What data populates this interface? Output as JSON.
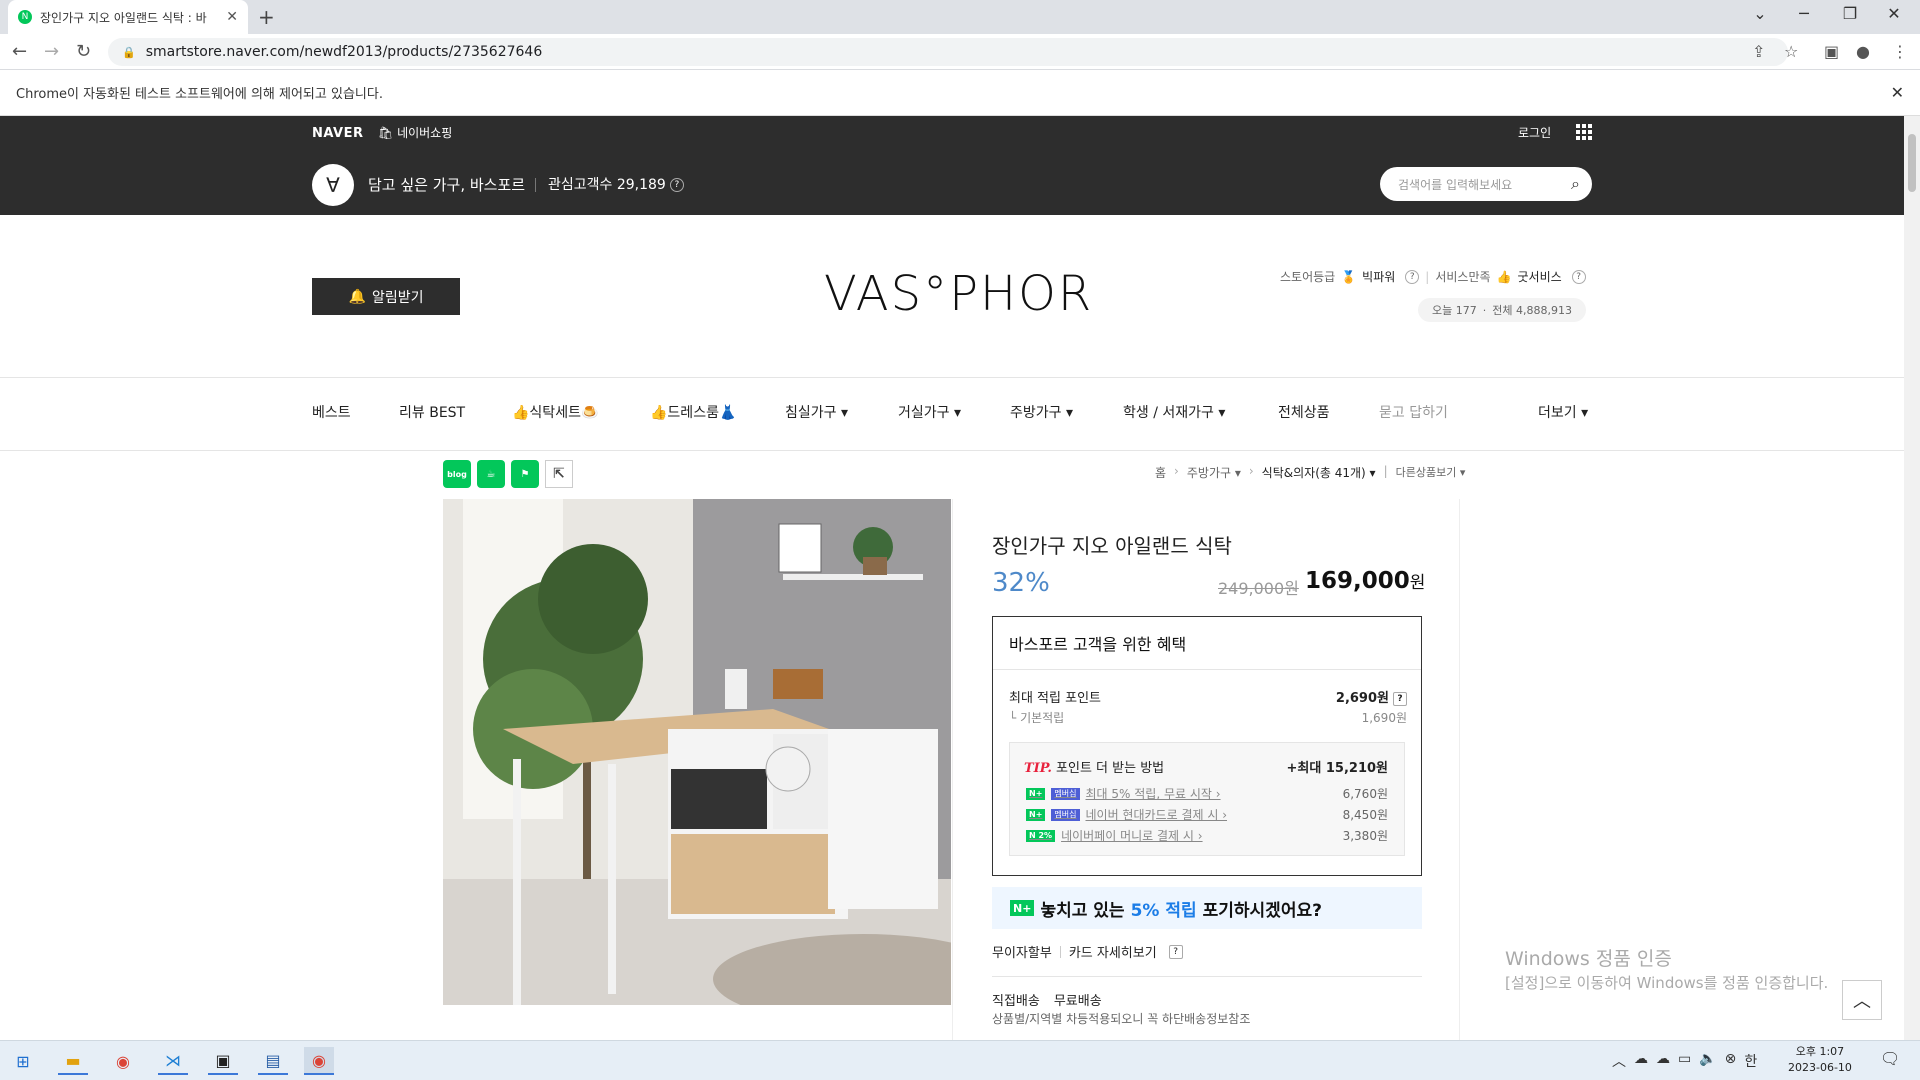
{
  "browser": {
    "tab_title": "장인가구 지오 아일랜드 식탁 : 바",
    "new_tab": "+",
    "url": "smartstore.naver.com/newdf2013/products/2735627646",
    "automation_notice": "Chrome이 자동화된 테스트 소프트웨어에 의해 제어되고 있습니다."
  },
  "topbar": {
    "naver": "NAVER",
    "naver_shopping": "네이버쇼핑",
    "login": "로그인",
    "store_slogan": "담고 싶은 가구, 바스포르",
    "followers_label": "관심고객수 29,189",
    "search_placeholder": "검색어를 입력해보세요"
  },
  "store": {
    "alarm_button": "알림받기",
    "logo": "VAS°PHOR",
    "grade_label": "스토어등급",
    "grade_value": "빅파워",
    "service_label": "서비스만족",
    "service_value": "굿서비스",
    "today": "오늘 177",
    "total": "전체 4,888,913"
  },
  "categories": [
    "베스트",
    "리뷰 BEST",
    "👍식탁세트🍮",
    "👍드레스룸👗",
    "침실가구 ▾",
    "거실가구 ▾",
    "주방가구 ▾",
    "학생 / 서재가구 ▾",
    "전체상품",
    "묻고 답하기",
    "더보기 ▾"
  ],
  "breadcrumb": {
    "home": "홈",
    "level1": "주방가구 ▾",
    "level2": "식탁&의자(총 41개) ▾",
    "other": "다른상품보기 ▾"
  },
  "product": {
    "name": "장인가구 지오 아일랜드 식탁",
    "discount": "32%",
    "original_price": "249,000원",
    "price": "169,000",
    "price_unit": "원"
  },
  "benefit": {
    "title": "바스포르 고객을 위한 혜택",
    "max_points_label": "최대 적립 포인트",
    "max_points_value": "2,690원",
    "basic_label": "기본적립",
    "basic_value": "1,690원",
    "tip_label": "TIP.",
    "tip_title": "포인트 더 받는 방법",
    "tip_max": "+최대 15,210원",
    "tips": [
      {
        "badge": "N+ 멤버십",
        "label": "최대 5% 적립, 무료 시작 ›",
        "value": "6,760원"
      },
      {
        "badge": "N+ 멤버십",
        "label": "네이버 현대카드로 결제 시 ›",
        "value": "8,450원"
      },
      {
        "badge": "N 2%",
        "label": "네이버페이 머니로 결제 시 ›",
        "value": "3,380원"
      }
    ]
  },
  "promo": {
    "badge": "N+",
    "text_a": "놓치고 있는",
    "text_b": "5% 적립",
    "text_c": "포기하시겠어요?"
  },
  "payment": {
    "installment": "무이자할부",
    "card_detail": "카드 자세히보기"
  },
  "shipping": {
    "type": "직접배송",
    "fee": "무료배송",
    "note": "상품별/지역별 차등적용되오니 꼭 하단배송정보참조"
  },
  "watermark": {
    "line1": "Windows 정품 인증",
    "line2": "[설정]으로 이동하여 Windows를 정품 인증합니다."
  },
  "taskbar": {
    "time": "오후 1:07",
    "date": "2023-06-10",
    "ime": "한"
  }
}
